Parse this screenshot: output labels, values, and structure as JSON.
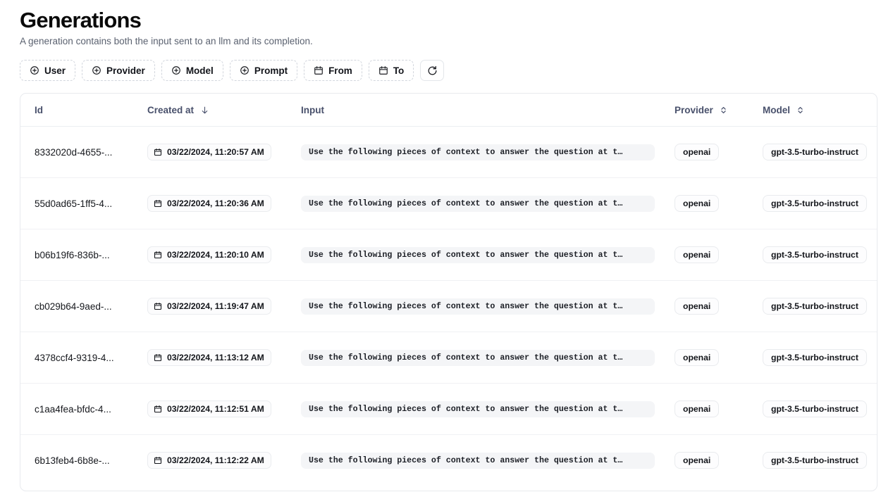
{
  "header": {
    "title": "Generations",
    "subtitle": "A generation contains both the input sent to an llm and its completion."
  },
  "toolbar": {
    "filters": [
      {
        "label": "User",
        "icon": "plus-circle-icon"
      },
      {
        "label": "Provider",
        "icon": "plus-circle-icon"
      },
      {
        "label": "Model",
        "icon": "plus-circle-icon"
      },
      {
        "label": "Prompt",
        "icon": "plus-circle-icon"
      },
      {
        "label": "From",
        "icon": "calendar-icon"
      },
      {
        "label": "To",
        "icon": "calendar-icon"
      }
    ],
    "refresh": {
      "icon": "refresh-icon",
      "label": ""
    }
  },
  "table": {
    "columns": [
      {
        "key": "id",
        "label": "Id",
        "sort": "none"
      },
      {
        "key": "created",
        "label": "Created at",
        "sort": "desc"
      },
      {
        "key": "input",
        "label": "Input",
        "sort": "none"
      },
      {
        "key": "provider",
        "label": "Provider",
        "sort": "sortable"
      },
      {
        "key": "model",
        "label": "Model",
        "sort": "sortable"
      }
    ],
    "rows": [
      {
        "id": "8332020d-4655-...",
        "created": "03/22/2024, 11:20:57 AM",
        "input": "Use the following pieces of context to answer the question at t…",
        "provider": "openai",
        "model": "gpt-3.5-turbo-instruct"
      },
      {
        "id": "55d0ad65-1ff5-4...",
        "created": "03/22/2024, 11:20:36 AM",
        "input": "Use the following pieces of context to answer the question at t…",
        "provider": "openai",
        "model": "gpt-3.5-turbo-instruct"
      },
      {
        "id": "b06b19f6-836b-...",
        "created": "03/22/2024, 11:20:10 AM",
        "input": "Use the following pieces of context to answer the question at t…",
        "provider": "openai",
        "model": "gpt-3.5-turbo-instruct"
      },
      {
        "id": "cb029b64-9aed-...",
        "created": "03/22/2024, 11:19:47 AM",
        "input": "Use the following pieces of context to answer the question at t…",
        "provider": "openai",
        "model": "gpt-3.5-turbo-instruct"
      },
      {
        "id": "4378ccf4-9319-4...",
        "created": "03/22/2024, 11:13:12 AM",
        "input": "Use the following pieces of context to answer the question at t…",
        "provider": "openai",
        "model": "gpt-3.5-turbo-instruct"
      },
      {
        "id": "c1aa4fea-bfdc-4...",
        "created": "03/22/2024, 11:12:51 AM",
        "input": "Use the following pieces of context to answer the question at t…",
        "provider": "openai",
        "model": "gpt-3.5-turbo-instruct"
      },
      {
        "id": "6b13feb4-6b8e-...",
        "created": "03/22/2024, 11:12:22 AM",
        "input": "Use the following pieces of context to answer the question at t…",
        "provider": "openai",
        "model": "gpt-3.5-turbo-instruct"
      }
    ]
  },
  "colors": {
    "text": "#0a0a0a",
    "muted": "#5b6270",
    "header_text": "#48506b",
    "border": "#e8eaee",
    "chip_bg": "#f4f5f7"
  }
}
